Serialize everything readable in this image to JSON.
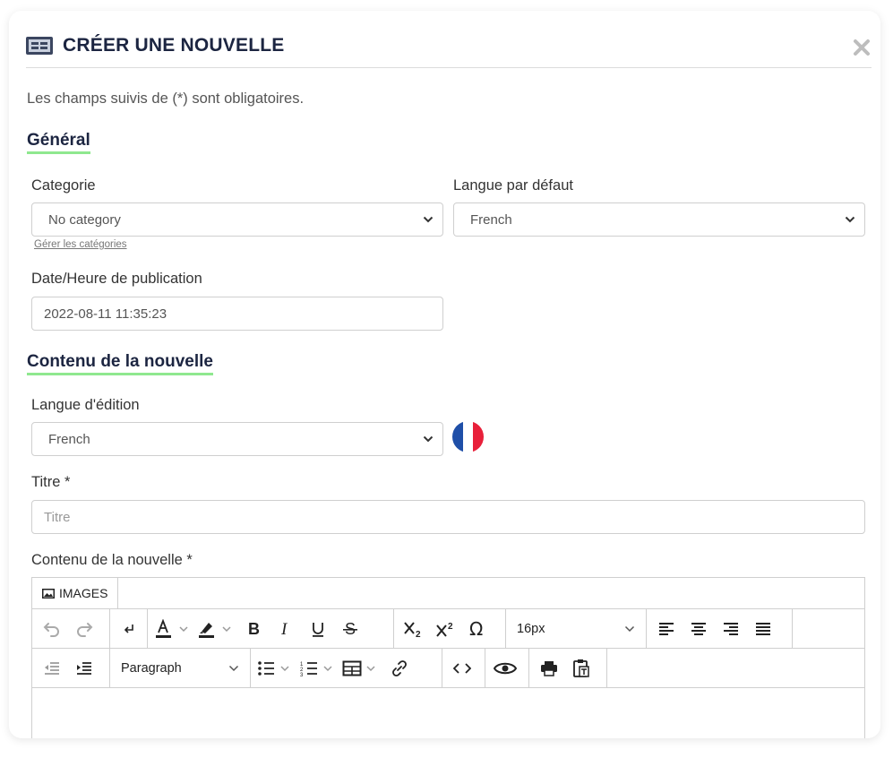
{
  "modal": {
    "title": "CRÉER UNE NOUVELLE",
    "required_note": "Les champs suivis de (*) sont obligatoires."
  },
  "general": {
    "section_title": "Général",
    "category_label": "Categorie",
    "category_value": "No category",
    "manage_categories_link": "Gérer les catégories",
    "default_language_label": "Langue par défaut",
    "default_language_value": "French",
    "publish_date_label": "Date/Heure de publication",
    "publish_date_value": "2022-08-11 11:35:23"
  },
  "content": {
    "section_title": "Contenu de la nouvelle",
    "edit_language_label": "Langue d'édition",
    "edit_language_value": "French",
    "title_label": "Titre *",
    "title_placeholder": "Titre",
    "body_label": "Contenu de la nouvelle *"
  },
  "editor": {
    "images_button": "IMAGES",
    "font_size": "16px",
    "block_format": "Paragraph",
    "icons": [
      "undo-icon",
      "redo-icon",
      "line-break-icon",
      "text-color-icon",
      "highlight-icon",
      "bold-icon",
      "italic-icon",
      "underline-icon",
      "strikethrough-icon",
      "subscript-icon",
      "superscript-icon",
      "special-char-icon",
      "align-left-icon",
      "align-center-icon",
      "align-right-icon",
      "justify-icon",
      "outdent-icon",
      "indent-icon",
      "bullet-list-icon",
      "numbered-list-icon",
      "table-icon",
      "link-icon",
      "code-icon",
      "preview-icon",
      "print-icon",
      "paste-text-icon"
    ]
  },
  "colors": {
    "title": "#1c2541",
    "section_underline": "#8fe88f",
    "flag_blue": "#1f4fa8",
    "flag_red": "#e8203a"
  }
}
